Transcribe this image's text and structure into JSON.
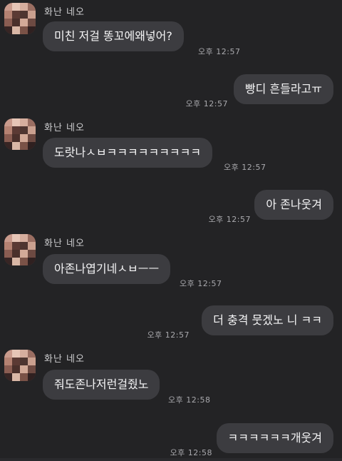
{
  "messages": [
    {
      "sender": "화난 네오",
      "text": "미친 저걸 똥꼬에왜넣어?",
      "time": "오후 12:57"
    },
    {
      "text": "빵디 흔들라고ㅠ",
      "time": "오후 12:57"
    },
    {
      "sender": "화난 네오",
      "text": "도랏나ㅅㅂㅋㅋㅋㅋㅋㅋㅋㅋㅋ",
      "time": "오후 12:57"
    },
    {
      "text": "아 존나웃겨",
      "time": "오후 12:57"
    },
    {
      "sender": "화난 네오",
      "text": "아존나엽기네ㅅㅂㅡㅡ",
      "time": "오후 12:57"
    },
    {
      "text": "더 충격 뭇겠노 니 ㅋㅋ",
      "time": "오후 12:57"
    },
    {
      "sender": "화난 네오",
      "text": "줘도존나저런걸줬노",
      "time": "오후 12:58"
    },
    {
      "text": "ㅋㅋㅋㅋㅋㅋ개웃겨",
      "time": "오후 12:58"
    }
  ],
  "colors": {
    "background": "#232325",
    "bubble": "#3c3c40",
    "text": "#f4f4f5",
    "timestamp": "#a9a9ad"
  }
}
